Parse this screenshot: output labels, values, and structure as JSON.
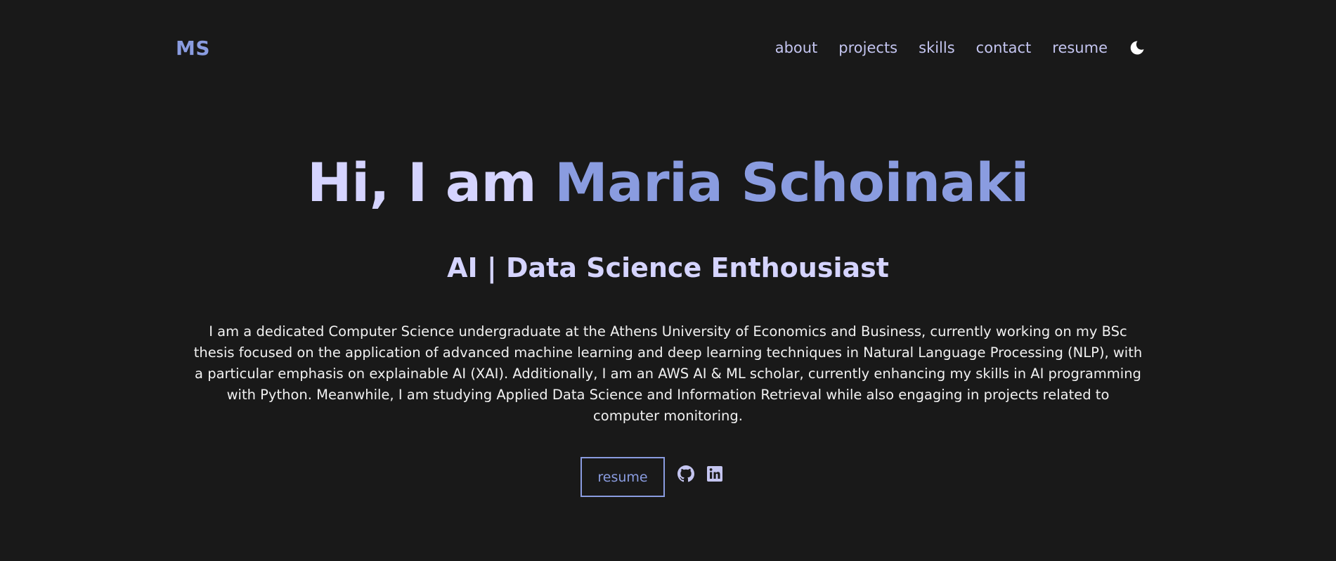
{
  "header": {
    "logo": "MS",
    "nav": [
      {
        "label": "about"
      },
      {
        "label": "projects"
      },
      {
        "label": "skills"
      },
      {
        "label": "contact"
      },
      {
        "label": "resume"
      }
    ],
    "theme_icon": "moon-icon"
  },
  "hero": {
    "greeting": "Hi, I am ",
    "name": "Maria Schoinaki",
    "subtitle": "AI | Data Science Enthousiast",
    "description": "I am a dedicated Computer Science undergraduate at the Athens University of Economics and Business, currently working on my BSc thesis focused on the application of advanced machine learning and deep learning techniques in Natural Language Processing (NLP), with a particular emphasis on explainable AI (XAI). Additionally, I am an AWS AI & ML scholar, currently enhancing my skills in AI programming with Python. Meanwhile, I am studying Applied Data Science and Information Retrieval while also engaging in projects related to computer monitoring."
  },
  "actions": {
    "resume_label": "resume",
    "social": [
      {
        "icon": "github-icon"
      },
      {
        "icon": "linkedin-icon"
      }
    ]
  },
  "colors": {
    "background": "#191919",
    "accent": "#8a9ce0",
    "light": "#d5d4ff",
    "text": "#f1f1f1"
  }
}
